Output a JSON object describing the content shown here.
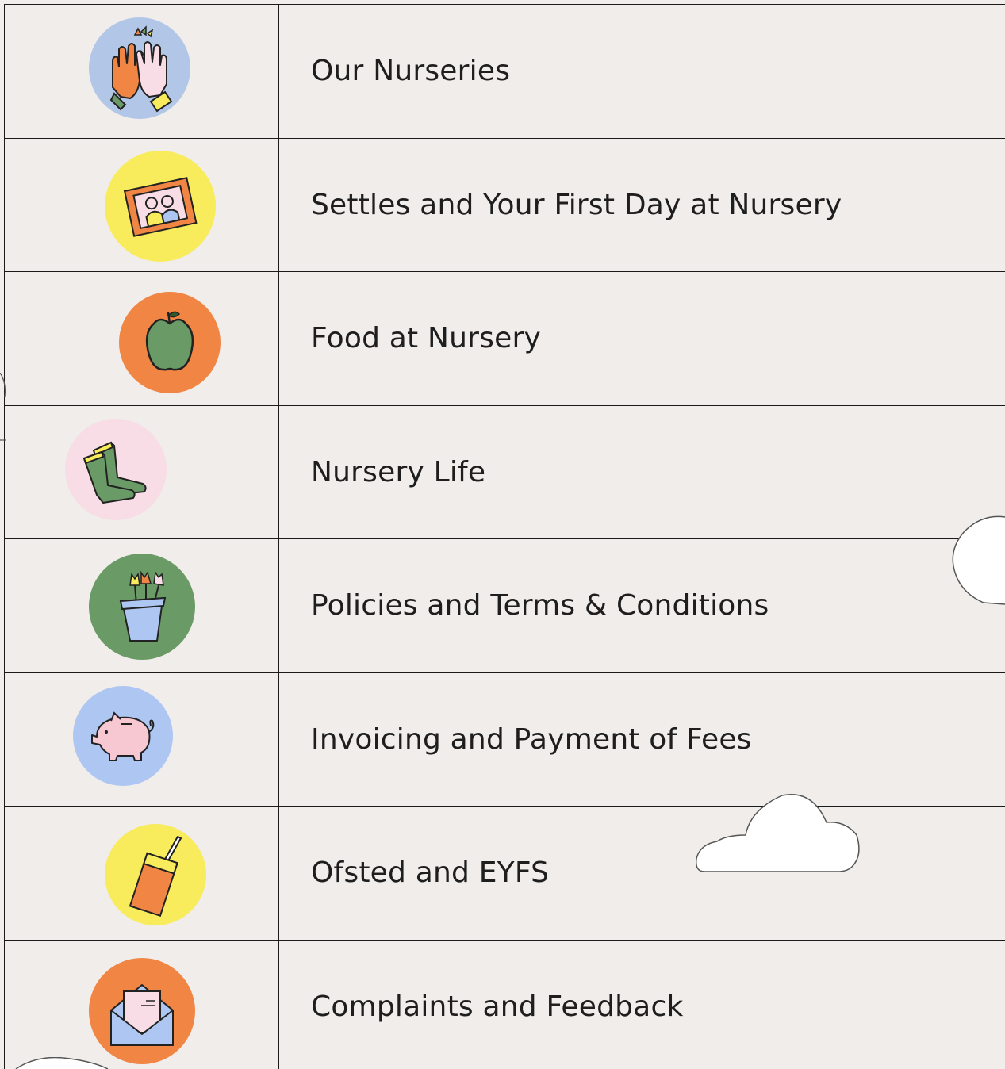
{
  "menu": {
    "items": [
      {
        "label": "Our Nurseries",
        "icon": "high-five-hands-icon",
        "circle_color": "#b2c7e8"
      },
      {
        "label": "Settles and Your First Day at Nursery",
        "icon": "family-picture-frame-icon",
        "circle_color": "#f8ec5c"
      },
      {
        "label": "Food at Nursery",
        "icon": "apple-icon",
        "circle_color": "#f08544"
      },
      {
        "label": "Nursery Life",
        "icon": "wellington-boots-icon",
        "circle_color": "#f8dde6"
      },
      {
        "label": "Policies and Terms & Conditions",
        "icon": "flower-pot-icon",
        "circle_color": "#6a9b66"
      },
      {
        "label": "Invoicing and Payment of Fees",
        "icon": "piggy-bank-icon",
        "circle_color": "#aec6f2"
      },
      {
        "label": "Ofsted and EYFS",
        "icon": "juice-carton-icon",
        "circle_color": "#f8ec5c"
      },
      {
        "label": "Complaints and Feedback",
        "icon": "envelope-letter-icon",
        "circle_color": "#f08544"
      }
    ]
  },
  "decorations": {
    "cloud_color": "#ffffff",
    "outline_color": "#555555"
  }
}
